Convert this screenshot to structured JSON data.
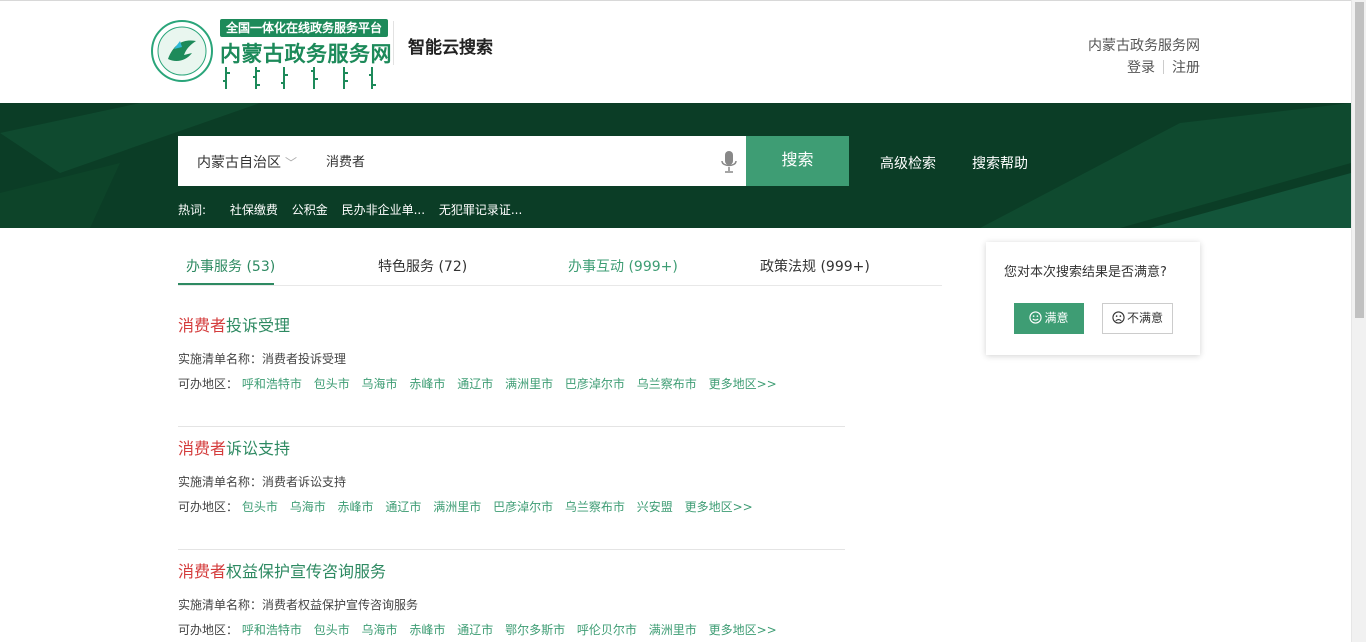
{
  "header": {
    "logo_subtitle": "全国一体化在线政务服务平台",
    "logo_title": "内蒙古政务服务网",
    "emblem_text": "内蒙古政务",
    "site_title": "智能云搜索",
    "portal_link": "内蒙古政务服务网",
    "login": "登录",
    "register": "注册"
  },
  "search": {
    "region": "内蒙古自治区",
    "query": "消费者",
    "button": "搜索",
    "advanced": "高级检索",
    "help": "搜索帮助",
    "hot_label": "热词:",
    "hot_words": [
      "社保缴费",
      "公积金",
      "民办非企业单...",
      "无犯罪记录证..."
    ]
  },
  "tabs": [
    {
      "label": "办事服务 (53)",
      "active": true
    },
    {
      "label": "特色服务 (72)",
      "active": false
    },
    {
      "label": "办事互动 (999+)",
      "active": false
    },
    {
      "label": "政策法规 (999+)",
      "active": false
    }
  ],
  "results": [
    {
      "title_highlight": "消费者",
      "title_rest": "投诉受理",
      "info": "实施清单名称：消费者投诉受理",
      "regions_label": "可办地区：",
      "regions": [
        "呼和浩特市",
        "包头市",
        "乌海市",
        "赤峰市",
        "通辽市",
        "满洲里市",
        "巴彦淖尔市",
        "乌兰察布市",
        "更多地区>>"
      ]
    },
    {
      "title_highlight": "消费者",
      "title_rest": "诉讼支持",
      "info": "实施清单名称：消费者诉讼支持",
      "regions_label": "可办地区：",
      "regions": [
        "包头市",
        "乌海市",
        "赤峰市",
        "通辽市",
        "满洲里市",
        "巴彦淖尔市",
        "乌兰察布市",
        "兴安盟",
        "更多地区>>"
      ]
    },
    {
      "title_highlight": "消费者",
      "title_rest": "权益保护宣传咨询服务",
      "info": "实施清单名称：消费者权益保护宣传咨询服务",
      "regions_label": "可办地区：",
      "regions": [
        "呼和浩特市",
        "包头市",
        "乌海市",
        "赤峰市",
        "通辽市",
        "鄂尔多斯市",
        "呼伦贝尔市",
        "满洲里市",
        "更多地区>>"
      ]
    }
  ],
  "feedback": {
    "question": "您对本次搜索结果是否满意?",
    "good": "满意",
    "bad": "不满意"
  },
  "colors": {
    "brand_green": "#3e9d74",
    "banner": "#0b3d26",
    "highlight_red": "#d43c3c"
  }
}
